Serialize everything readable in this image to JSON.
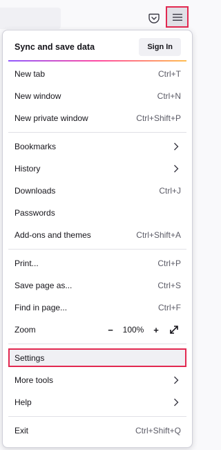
{
  "toolbar": {
    "pocket_icon": "pocket-icon",
    "menu_icon": "hamburger-menu-icon"
  },
  "menu": {
    "sync_label": "Sync and save data",
    "sign_in_label": "Sign In",
    "items": {
      "new_tab": {
        "label": "New tab",
        "shortcut": "Ctrl+T"
      },
      "new_window": {
        "label": "New window",
        "shortcut": "Ctrl+N"
      },
      "new_private": {
        "label": "New private window",
        "shortcut": "Ctrl+Shift+P"
      },
      "bookmarks": {
        "label": "Bookmarks"
      },
      "history": {
        "label": "History"
      },
      "downloads": {
        "label": "Downloads",
        "shortcut": "Ctrl+J"
      },
      "passwords": {
        "label": "Passwords"
      },
      "addons": {
        "label": "Add-ons and themes",
        "shortcut": "Ctrl+Shift+A"
      },
      "print": {
        "label": "Print...",
        "shortcut": "Ctrl+P"
      },
      "save_page": {
        "label": "Save page as...",
        "shortcut": "Ctrl+S"
      },
      "find": {
        "label": "Find in page...",
        "shortcut": "Ctrl+F"
      },
      "zoom": {
        "label": "Zoom",
        "minus": "−",
        "value": "100%",
        "plus": "+"
      },
      "settings": {
        "label": "Settings"
      },
      "more_tools": {
        "label": "More tools"
      },
      "help": {
        "label": "Help"
      },
      "exit": {
        "label": "Exit",
        "shortcut": "Ctrl+Shift+Q"
      }
    }
  },
  "colors": {
    "highlight": "#e22850",
    "accent_gradient": [
      "#9059ff",
      "#ff4aa2",
      "#ffbd4f"
    ]
  }
}
